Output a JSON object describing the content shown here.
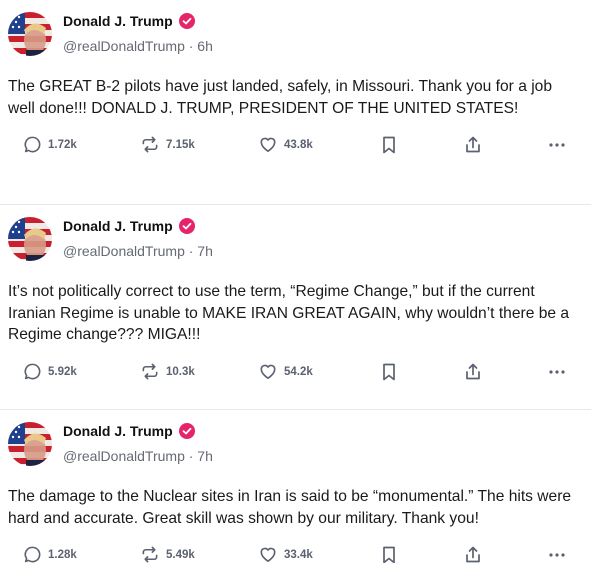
{
  "posts": [
    {
      "name": "Donald J. Trump",
      "handle": "@realDonaldTrump",
      "time": "· 6h",
      "text": "The GREAT B-2 pilots have just landed, safely, in Missouri. Thank you for a job well done!!! DONALD J. TRUMP, PRESIDENT OF THE UNITED STATES!",
      "replies": "1.72k",
      "retruths": "7.15k",
      "likes": "43.8k"
    },
    {
      "name": "Donald J. Trump",
      "handle": "@realDonaldTrump",
      "time": "· 7h",
      "text": "It’s not politically correct to use the term, “Regime Change,” but if the current Iranian Regime is unable to MAKE IRAN GREAT AGAIN, why wouldn’t there be a Regime change??? MIGA!!!",
      "replies": "5.92k",
      "retruths": "10.3k",
      "likes": "54.2k"
    },
    {
      "name": "Donald J. Trump",
      "handle": "@realDonaldTrump",
      "time": "· 7h",
      "text": "The damage to the Nuclear sites in Iran is said to be “monumental.” The hits were hard and accurate. Great skill was shown by our military. Thank you!",
      "replies": "1.28k",
      "retruths": "5.49k",
      "likes": "33.4k"
    }
  ],
  "icons": {
    "reply": "speech-bubble-icon",
    "retruth": "repost-arrows-icon",
    "like": "heart-icon",
    "save": "bookmark-icon",
    "share": "share-upload-icon",
    "more": "ellipsis-icon",
    "verified": "verified-badge-icon"
  },
  "colors": {
    "verified": "#e5246a",
    "action": "#5b6170",
    "handle": "#656a73"
  }
}
